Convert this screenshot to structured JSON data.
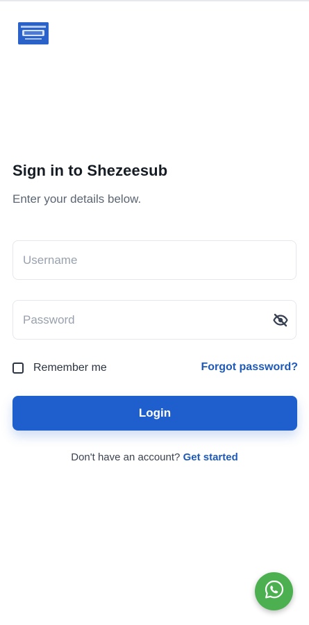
{
  "logo": {
    "icon": "brand-logo",
    "color": "#2b62c9"
  },
  "header": {
    "title": "Sign in to Shezeesub",
    "subtitle": "Enter your details below."
  },
  "form": {
    "username": {
      "placeholder": "Username",
      "value": ""
    },
    "password": {
      "placeholder": "Password",
      "value": "",
      "toggle_icon": "eye-off-icon"
    },
    "remember_label": "Remember me",
    "remember_checked": false,
    "forgot_label": "Forgot password?",
    "login_label": "Login"
  },
  "footer": {
    "prompt": "Don't have an account?",
    "link_label": "Get started"
  },
  "fab": {
    "icon": "whatsapp-icon",
    "color": "#4caf50"
  },
  "colors": {
    "accent": "#1f5fcd",
    "link": "#1e59b8"
  }
}
